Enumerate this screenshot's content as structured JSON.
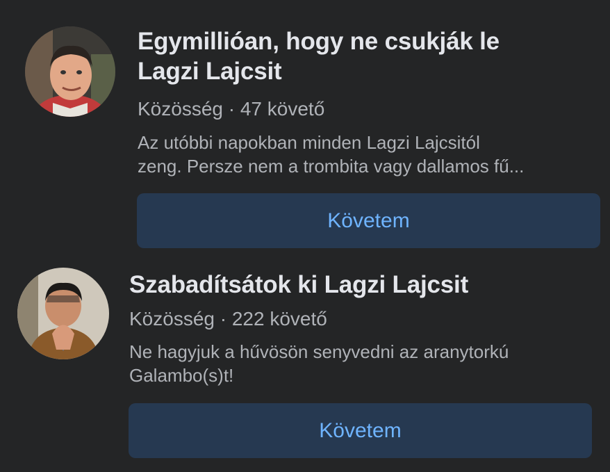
{
  "results": [
    {
      "title_line1": "Egymillióan, hogy ne csukják le",
      "title_line2": "Lagzi Lajcsit",
      "category": "Közösség",
      "separator": "·",
      "followers": "47 követő",
      "desc_line1": "Az utóbbi napokban minden Lagzi Lajcsitól",
      "desc_line2": "zeng. Persze nem a trombita vagy dallamos fű...",
      "button_label": "Követem"
    },
    {
      "title_line1": "Szabadítsátok ki Lagzi Lajcsit",
      "category": "Közösség",
      "separator": "·",
      "followers": "222 követő",
      "desc_line1": "Ne hagyjuk a hűvösön senyvedni az aranytorkú",
      "desc_line2": "Galambo(s)t!",
      "button_label": "Követem"
    }
  ],
  "colors": {
    "background": "#242526",
    "title": "#e4e6eb",
    "secondary_text": "#b0b3b8",
    "button_bg": "#263951",
    "button_text": "#6fb4ff"
  }
}
